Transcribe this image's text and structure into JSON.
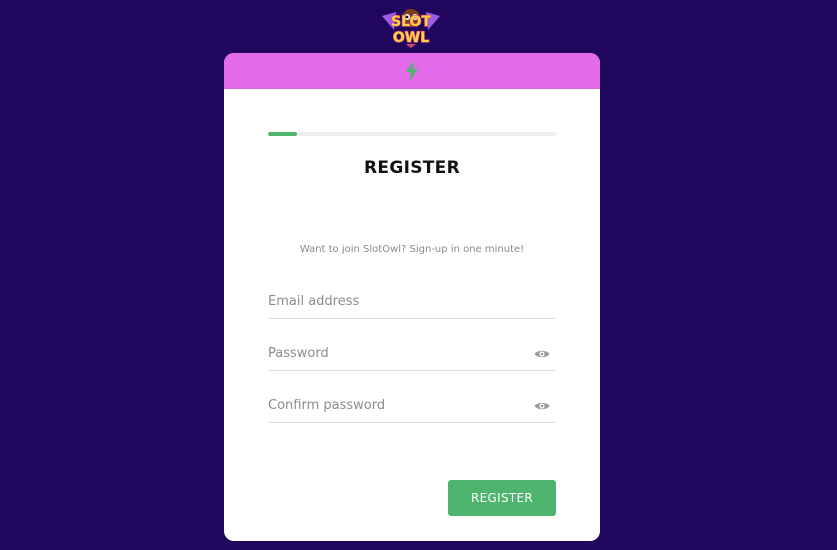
{
  "logo": {
    "line1": "SLOT",
    "line2": "OWL"
  },
  "header": {
    "icon": "bolt-icon"
  },
  "progress": {
    "fraction": 0.1
  },
  "form": {
    "title": "REGISTER",
    "subtitle": "Want to join SlotOwl? Sign-up in one minute!",
    "email": {
      "placeholder": "Email address",
      "value": ""
    },
    "password": {
      "placeholder": "Password",
      "value": "",
      "icon": "eye-icon"
    },
    "confirm": {
      "placeholder": "Confirm password",
      "value": "",
      "icon": "eye-icon"
    },
    "submit_label": "REGISTER"
  },
  "colors": {
    "background": "#21065d",
    "header": "#e36bea",
    "accent": "#4fb56e"
  }
}
